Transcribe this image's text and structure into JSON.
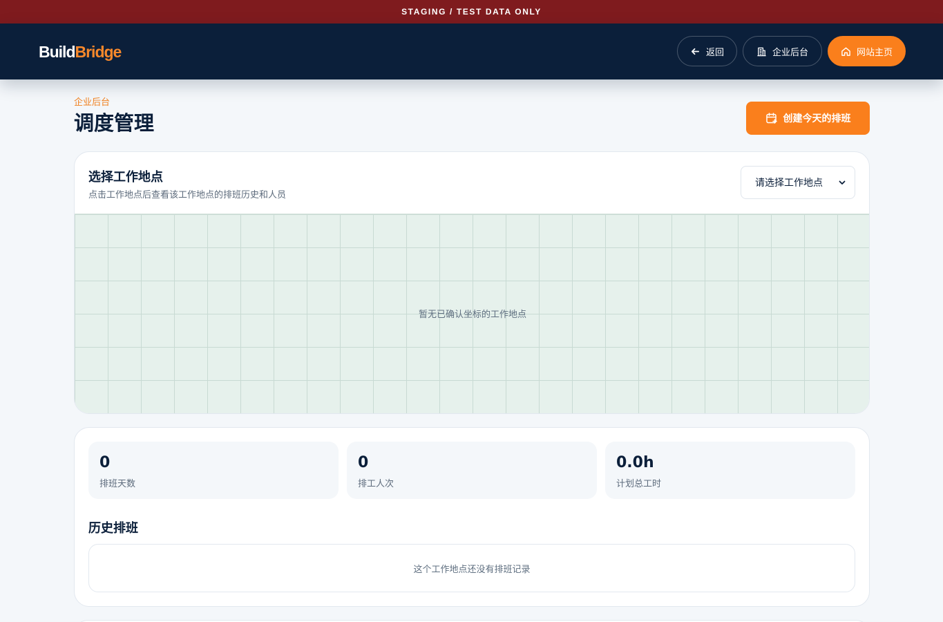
{
  "banner": {
    "text": "STAGING / TEST DATA ONLY"
  },
  "header": {
    "logo": {
      "part1": "Build",
      "part2": "Bridge"
    },
    "nav": {
      "back_label": "返回",
      "admin_label": "企业后台",
      "home_label": "网站主页"
    }
  },
  "page": {
    "eyebrow": "企业后台",
    "title": "调度管理",
    "create_label": "创建今天的排班"
  },
  "site_picker": {
    "title": "选择工作地点",
    "subtitle": "点击工作地点后查看该工作地点的排班历史和人员",
    "select_value": "请选择工作地点",
    "map_empty": "暂无已确认坐标的工作地点"
  },
  "stats": [
    {
      "value": "0",
      "label": "排班天数"
    },
    {
      "value": "0",
      "label": "排工人次"
    },
    {
      "value": "0.0h",
      "label": "计划总工时"
    }
  ],
  "history": {
    "title": "历史排班",
    "empty": "这个工作地点还没有排班记录"
  },
  "icons": {
    "back": "arrow-left-icon",
    "admin": "building-icon",
    "home": "home-icon",
    "create": "calendar-plus-icon",
    "select": "chevron-down-icon"
  },
  "colors": {
    "banner": "#7f1b1e",
    "header": "#0b1f3a",
    "accent": "#fa7f1c"
  }
}
